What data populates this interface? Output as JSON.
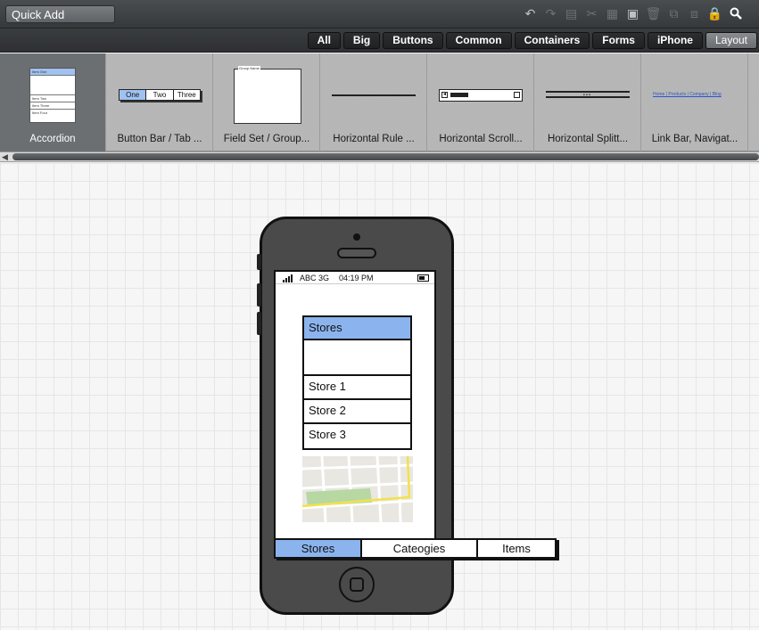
{
  "toolbar": {
    "quick_add_value": "Quick Add",
    "icons": [
      "undo-icon",
      "redo-icon",
      "copy-icon",
      "cut-icon",
      "paste-icon",
      "clipboard-icon",
      "delete-icon",
      "group-icon",
      "ungroup-icon",
      "lock-icon",
      "search-icon"
    ]
  },
  "filter_tabs": [
    "All",
    "Big",
    "Buttons",
    "Common",
    "Containers",
    "Forms",
    "iPhone",
    "Layout"
  ],
  "active_filter": "Layout",
  "gallery": {
    "items": [
      {
        "label": "Accordion",
        "selected": true
      },
      {
        "label": "Button Bar / Tab ..."
      },
      {
        "label": "Field Set / Group..."
      },
      {
        "label": "Horizontal Rule ..."
      },
      {
        "label": "Horizontal Scroll..."
      },
      {
        "label": "Horizontal Splitt..."
      },
      {
        "label": "Link Bar, Navigat..."
      }
    ],
    "thumb_texts": {
      "accordion_rows": [
        "Item One",
        "Item Two",
        "Item Three",
        "Item Four"
      ],
      "button_bar": [
        "One",
        "Two",
        "Three"
      ],
      "group_name": "Group Name",
      "link_bar": "Home | Products | Company | Blog"
    }
  },
  "phone": {
    "status": {
      "carrier": "ABC 3G",
      "time": "04:19 PM"
    },
    "accordion": {
      "header": "Stores",
      "items": [
        "Store 1",
        "Store 2",
        "Store 3"
      ]
    },
    "tab_bar": [
      "Stores",
      "Cateogies",
      "Items"
    ]
  },
  "colors": {
    "selection_blue": "#8bb4ee",
    "toolbar_dark": "#36393c"
  }
}
